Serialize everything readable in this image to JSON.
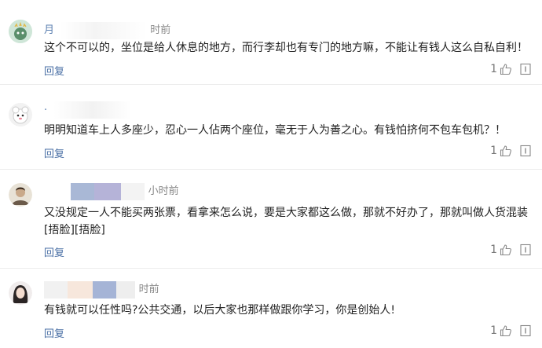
{
  "comments": [
    {
      "name": "月",
      "time": "时前",
      "text": "这个不可以的，坐位是给人休息的地方，而行李却也有专门的地方嘛，不能让有钱人这么自私自利！",
      "reply_label": "回复",
      "likes": "1"
    },
    {
      "name": "·",
      "time": "",
      "text": "明明知道车上人多座少，忍心一人佔两个座位，毫无于人为善之心。有钱怕挤何不包车包机？！",
      "reply_label": "回复",
      "likes": "1"
    },
    {
      "name": "",
      "time": "小时前",
      "text": "又没规定一人不能买两张票，看拿来怎么说，要是大家都这么做，那就不好办了，那就叫做人货混装",
      "text2": "[捂脸][捂脸]",
      "reply_label": "回复",
      "likes": "1"
    },
    {
      "name": "",
      "time": "时前",
      "text": "有钱就可以任性吗?公共交通，以后大家也那样做跟你学习，你是创始人!",
      "reply_label": "回复",
      "likes": "1"
    }
  ],
  "colors": {
    "link": "#4a6fa5",
    "divider": "#ececec"
  }
}
